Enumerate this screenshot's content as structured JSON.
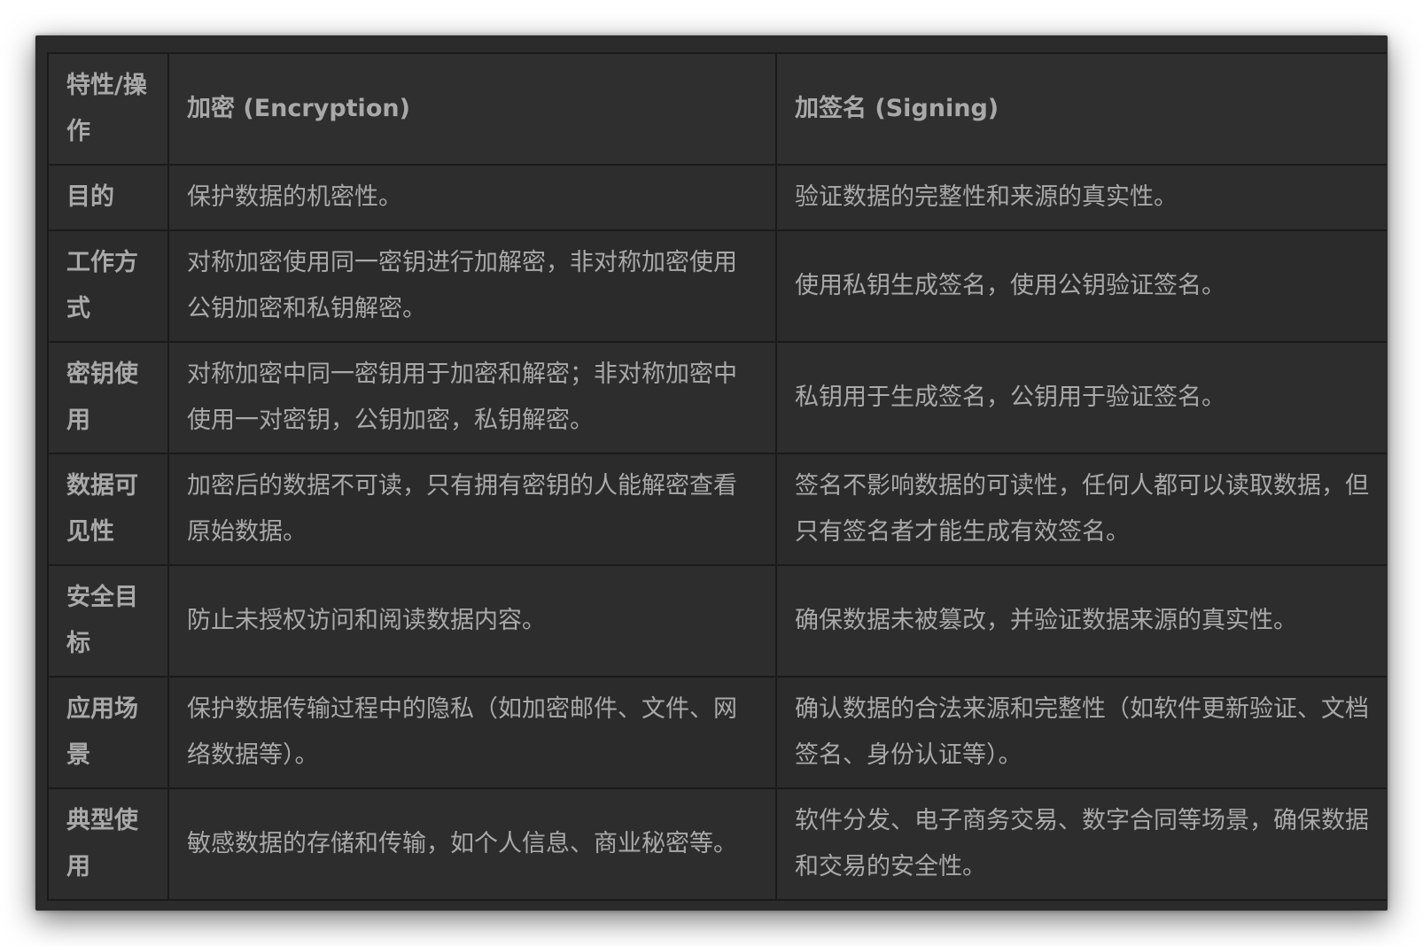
{
  "table": {
    "headers": [
      "特性/操作",
      "加密 (Encryption)",
      "加签名 (Signing)"
    ],
    "rows": [
      [
        "目的",
        "保护数据的机密性。",
        "验证数据的完整性和来源的真实性。"
      ],
      [
        "工作方式",
        "对称加密使用同一密钥进行加解密，非对称加密使用公钥加密和私钥解密。",
        "使用私钥生成签名，使用公钥验证签名。"
      ],
      [
        "密钥使用",
        "对称加密中同一密钥用于加密和解密；非对称加密中使用一对密钥，公钥加密，私钥解密。",
        "私钥用于生成签名，公钥用于验证签名。"
      ],
      [
        "数据可见性",
        "加密后的数据不可读，只有拥有密钥的人能解密查看原始数据。",
        "签名不影响数据的可读性，任何人都可以读取数据，但只有签名者才能生成有效签名。"
      ],
      [
        "安全目标",
        "防止未授权访问和阅读数据内容。",
        "确保数据未被篡改，并验证数据来源的真实性。"
      ],
      [
        "应用场景",
        "保护数据传输过程中的隐私（如加密邮件、文件、网络数据等）。",
        "确认数据的合法来源和完整性（如软件更新验证、文档签名、身份认证等）。"
      ],
      [
        "典型使用",
        "敏感数据的存储和传输，如个人信息、商业秘密等。",
        "软件分发、电子商务交易、数字合同等场景，确保数据和交易的安全性。"
      ]
    ]
  }
}
